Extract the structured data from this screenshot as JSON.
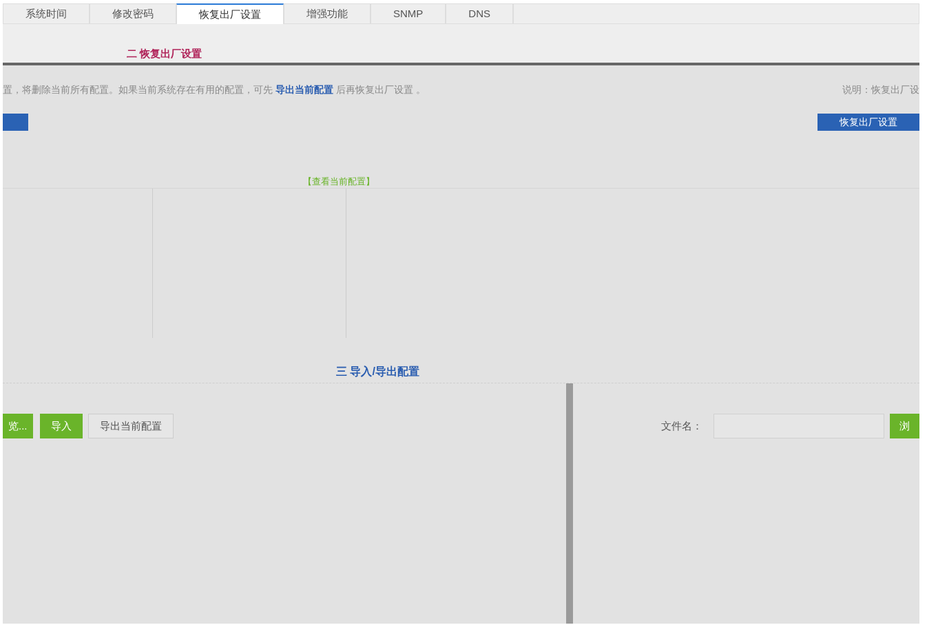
{
  "tabs": [
    {
      "label": "系统时间",
      "selected": false
    },
    {
      "label": "修改密码",
      "selected": false
    },
    {
      "label": "恢复出厂设置",
      "selected": true
    },
    {
      "label": "增强功能",
      "selected": false
    },
    {
      "label": "SNMP",
      "selected": false
    },
    {
      "label": "DNS",
      "selected": false
    }
  ],
  "reset_section": {
    "title": "二 恢复出厂设置",
    "description": "置，将删除当前所有配置。如果当前系统存在有用的配置，可先 **导出当前配置** 后再恢复出厂设置 。",
    "note": "说明：恢复出厂设",
    "button": "恢复出厂设置"
  },
  "config_view": {
    "link": "【查看当前配置】"
  },
  "import_export": {
    "title": "三 导入/导出配置",
    "browse_button": "览...",
    "import_button": "导入",
    "export_button": "导出当前配置",
    "file_label": "文件名：",
    "file_browse_button": "浏"
  }
}
